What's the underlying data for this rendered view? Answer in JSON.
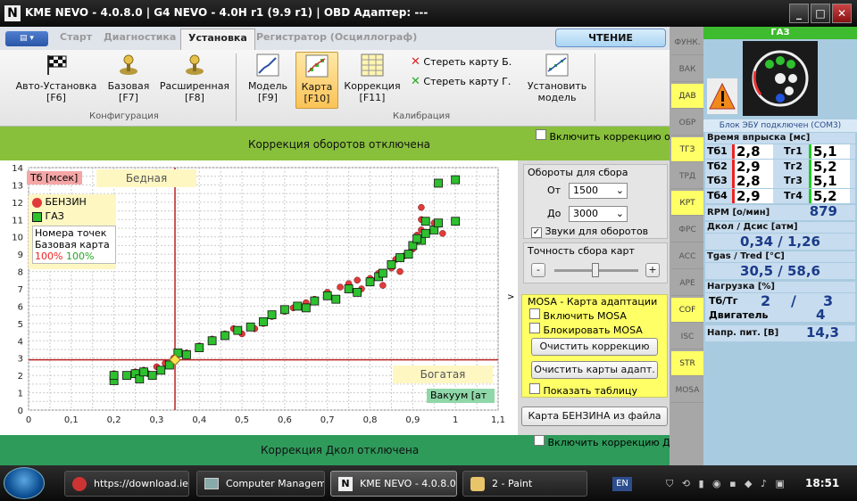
{
  "window": {
    "title": "KME NEVO - 4.0.8.0  |  G4 NEVO - 4.0H r1 (9.9 r1)  |  OBD Адаптер: ---"
  },
  "tabs": [
    "Старт",
    "Диагностика",
    "Установка",
    "Регистратор (Осциллограф)"
  ],
  "read_button": "ЧТЕНИЕ",
  "ribbon": {
    "auto_setup": [
      "Авто-Установка",
      "[F6]"
    ],
    "base": [
      "Базовая",
      "[F7]"
    ],
    "extended": [
      "Расширенная",
      "[F8]"
    ],
    "config_group": "Конфигурация",
    "model": [
      "Модель",
      "[F9]"
    ],
    "map": [
      "Карта",
      "[F10]"
    ],
    "correction": [
      "Коррекция",
      "[F11]"
    ],
    "erase_b": "Стереть карту Б.",
    "erase_g": "Стереть карту Г.",
    "set_model": [
      "Установить",
      "модель"
    ],
    "calib_group": "Калибрация"
  },
  "rpm_correction_text": "Коррекция оборотов отключена",
  "enable_correction_1": "Включить коррекцию о",
  "chart_data": {
    "type": "scatter",
    "xlim": [
      0,
      1.1
    ],
    "ylim": [
      0,
      14
    ],
    "x_ticks": [
      "0",
      "0,1",
      "0,2",
      "0,3",
      "0,4",
      "0,5",
      "0,6",
      "0,7",
      "0,8",
      "0,9",
      "1",
      "1,1"
    ],
    "y_ticks": [
      "0",
      "1",
      "2",
      "3",
      "4",
      "5",
      "6",
      "7",
      "8",
      "9",
      "10",
      "11",
      "12",
      "13",
      "14"
    ],
    "ylabel": "Тб [мсек]",
    "lean_label": "Бедная",
    "rich_label": "Богатая",
    "vacuum_label": "Вакуум [ат",
    "legend": {
      "petrol": "БЕНЗИН",
      "gas": "ГАЗ",
      "points_title": "Номера точек",
      "base_map": "Базовая карта",
      "pct_petrol": "100%",
      "pct_gas": "100%"
    },
    "crosshair": {
      "x": 0.343,
      "y": 2.9
    },
    "series": [
      {
        "name": "БЕНЗИН",
        "color": "#e23a3a",
        "marker": "circle",
        "points": [
          [
            0.2,
            1.8
          ],
          [
            0.2,
            2.1
          ],
          [
            0.23,
            2.0
          ],
          [
            0.25,
            2.2
          ],
          [
            0.26,
            1.9
          ],
          [
            0.27,
            2.3
          ],
          [
            0.28,
            2.1
          ],
          [
            0.3,
            2.5
          ],
          [
            0.32,
            2.7
          ],
          [
            0.34,
            3.0
          ],
          [
            0.37,
            3.3
          ],
          [
            0.4,
            3.7
          ],
          [
            0.43,
            4.1
          ],
          [
            0.46,
            4.4
          ],
          [
            0.48,
            4.7
          ],
          [
            0.5,
            4.4
          ],
          [
            0.53,
            4.7
          ],
          [
            0.55,
            5.0
          ],
          [
            0.57,
            5.4
          ],
          [
            0.6,
            5.7
          ],
          [
            0.62,
            5.9
          ],
          [
            0.65,
            6.2
          ],
          [
            0.67,
            6.4
          ],
          [
            0.7,
            6.8
          ],
          [
            0.73,
            7.1
          ],
          [
            0.75,
            7.3
          ],
          [
            0.77,
            7.5
          ],
          [
            0.78,
            7.0
          ],
          [
            0.8,
            7.6
          ],
          [
            0.82,
            7.9
          ],
          [
            0.83,
            7.2
          ],
          [
            0.85,
            8.2
          ],
          [
            0.86,
            8.7
          ],
          [
            0.87,
            8.0
          ],
          [
            0.88,
            8.9
          ],
          [
            0.9,
            9.3
          ],
          [
            0.91,
            10.1
          ],
          [
            0.92,
            10.4
          ],
          [
            0.92,
            11.0
          ],
          [
            0.92,
            11.7
          ],
          [
            0.95,
            10.8
          ],
          [
            0.95,
            10.4
          ],
          [
            0.97,
            10.2
          ]
        ]
      },
      {
        "name": "ГАЗ",
        "color": "#2ec02e",
        "marker": "square",
        "points": [
          [
            0.2,
            1.7
          ],
          [
            0.2,
            2.0
          ],
          [
            0.23,
            2.0
          ],
          [
            0.25,
            2.1
          ],
          [
            0.26,
            1.8
          ],
          [
            0.27,
            2.2
          ],
          [
            0.29,
            2.0
          ],
          [
            0.31,
            2.3
          ],
          [
            0.33,
            2.6
          ],
          [
            0.35,
            3.3
          ],
          [
            0.37,
            3.2
          ],
          [
            0.4,
            3.6
          ],
          [
            0.43,
            4.0
          ],
          [
            0.46,
            4.3
          ],
          [
            0.49,
            4.6
          ],
          [
            0.52,
            4.8
          ],
          [
            0.55,
            5.1
          ],
          [
            0.57,
            5.5
          ],
          [
            0.6,
            5.8
          ],
          [
            0.63,
            6.0
          ],
          [
            0.65,
            5.9
          ],
          [
            0.67,
            6.3
          ],
          [
            0.7,
            6.6
          ],
          [
            0.72,
            6.4
          ],
          [
            0.75,
            7.0
          ],
          [
            0.77,
            6.8
          ],
          [
            0.8,
            7.4
          ],
          [
            0.82,
            7.7
          ],
          [
            0.83,
            7.9
          ],
          [
            0.85,
            8.4
          ],
          [
            0.87,
            8.8
          ],
          [
            0.89,
            9.0
          ],
          [
            0.9,
            9.5
          ],
          [
            0.92,
            9.8
          ],
          [
            0.93,
            10.2
          ],
          [
            0.95,
            10.4
          ],
          [
            0.96,
            13.1
          ],
          [
            1.0,
            13.3
          ],
          [
            1.0,
            10.9
          ],
          [
            0.96,
            10.8
          ],
          [
            0.93,
            10.9
          ],
          [
            0.91,
            9.9
          ]
        ]
      }
    ]
  },
  "controls": {
    "rpm_group": "Обороты для сбора",
    "from_label": "От",
    "from_value": "1500",
    "to_label": "До",
    "to_value": "3000",
    "sounds_label": "Звуки для оборотов",
    "precision_group": "Точность сбора карт",
    "minus": "-",
    "plus": "+",
    "mosa_group": "MOSA - Карта адаптации",
    "enable_mosa": "Включить MOSA",
    "block_mosa": "Блокировать MOSA",
    "clear_correction": "Очистить коррекцию",
    "clear_adapt": "Очистить карты адапт.",
    "show_table": "Показать таблицу",
    "petrol_map_from_file": "Карта БЕНЗИНА из файла"
  },
  "dkol_correction_text": "Коррекция Дкол отключена",
  "enable_correction_2": "Включить коррекцию Д",
  "side_tabs": [
    "ФУНК.",
    "ВАК",
    "ДАВ",
    "ОБР",
    "ТГЗ",
    "ТРД",
    "КРТ",
    "ФРС",
    "АСС",
    "АРЕ",
    "COF",
    "ISC",
    "STR",
    "MOSA"
  ],
  "panel": {
    "header": "ГАЗ",
    "ecu_status": "Блок ЭБУ подключен (COM3)",
    "inj_title": "Время впрыска [мс]",
    "inj": [
      [
        "Тб1",
        "2,8",
        "Тг1",
        "5,1"
      ],
      [
        "Тб2",
        "2,9",
        "Тг2",
        "5,2"
      ],
      [
        "Тб3",
        "2,8",
        "Тг3",
        "5,1"
      ],
      [
        "Тб4",
        "2,9",
        "Тг4",
        "5,2"
      ]
    ],
    "rpm_label": "RPM [о/мин]",
    "rpm_value": "879",
    "pressure_title": "Дкол / Дсис [атм]",
    "pressure_value": "0,34  /  1,26",
    "temp_title": "Tgas / Tred [°C]",
    "temp_value": "30,5  /  58,6",
    "load_title": "Нагрузка [%]",
    "load_tb": "Тб/Тг",
    "load_a": "2",
    "load_slash": "/",
    "load_b": "3",
    "engine_label": "Двигатель",
    "engine_value": "4",
    "voltage_label": "Напр. пит. [В]",
    "voltage_value": "14,3"
  },
  "taskbar": {
    "items": [
      "https://download.ie...",
      "Computer Management",
      "KME NEVO - 4.0.8.0 ...",
      "2 - Paint"
    ],
    "lang": "EN",
    "time": "18:51"
  }
}
